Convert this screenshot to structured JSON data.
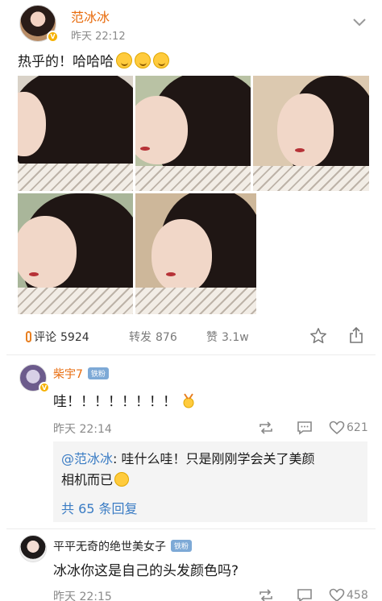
{
  "post": {
    "author": "范冰冰",
    "time": "昨天 22:12",
    "text": "热乎的！哈哈哈",
    "emoji_count": 3,
    "photo_count": 5,
    "actions": {
      "comment_label": "评论",
      "comment_count": "5924",
      "repost_label": "转发",
      "repost_count": "876",
      "like_label": "赞",
      "like_count": "3.1w"
    }
  },
  "comments": [
    {
      "author": "柴宇7",
      "badge": "铁粉",
      "text": "哇！！！！！！！！",
      "time": "昨天  22:14",
      "likes": "621",
      "reply": {
        "mention": "@范冰冰",
        "text_line1": ": 哇什么哇！只是刚刚学会关了美颜",
        "text_line2": "相机而已",
        "more": "共 65 条回复"
      }
    },
    {
      "author": "平平无奇的绝世美女子",
      "badge": "铁粉",
      "text": "冰冰你这是自己的头发颜色吗?",
      "time": "昨天  22:15",
      "likes": "458"
    }
  ],
  "colors": {
    "name_orange": "#e86b0c",
    "link_blue": "#3a7cc4",
    "verified_gold": "#f6b100",
    "badge_blue": "#7da9d6"
  },
  "icons": [
    "chevron-down-icon",
    "thermometer-icon",
    "star-icon",
    "share-icon",
    "repost-icon",
    "comment-icon",
    "heart-icon"
  ]
}
